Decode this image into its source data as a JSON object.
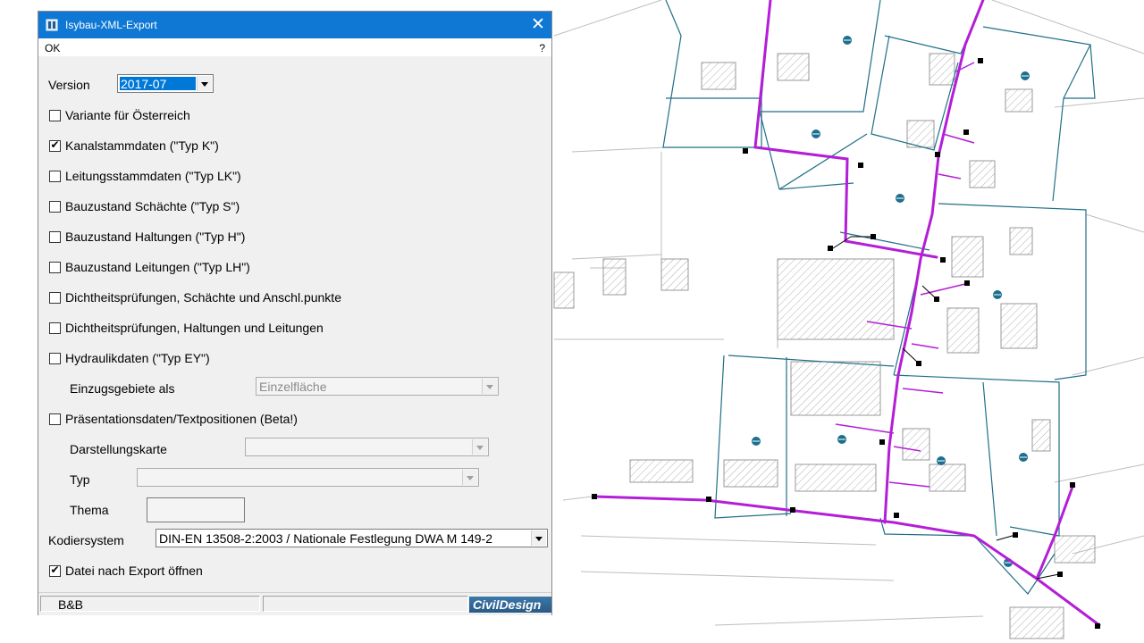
{
  "window": {
    "title": "Isybau-XML-Export",
    "menu_ok": "OK",
    "menu_help": "?",
    "close_symbol": "✕"
  },
  "form": {
    "version_label": "Version",
    "version_value": "2017-07",
    "checkboxes": [
      {
        "label": "Variante für Österreich",
        "checked": false
      },
      {
        "label": "Kanalstammdaten (\"Typ K\")",
        "checked": true
      },
      {
        "label": "Leitungsstammdaten (\"Typ LK\")",
        "checked": false
      },
      {
        "label": "Bauzustand Schächte (\"Typ S\")",
        "checked": false
      },
      {
        "label": "Bauzustand Haltungen (\"Typ H\")",
        "checked": false
      },
      {
        "label": "Bauzustand Leitungen (\"Typ LH\")",
        "checked": false
      },
      {
        "label": "Dichtheitsprüfungen, Schächte und Anschl.punkte",
        "checked": false
      },
      {
        "label": "Dichtheitsprüfungen, Haltungen und Leitungen",
        "checked": false
      },
      {
        "label": "Hydraulikdaten (\"Typ EY\")",
        "checked": false
      }
    ],
    "einzugsgebiete_label": "Einzugsgebiete als",
    "einzugsgebiete_value": "Einzelfläche",
    "praesentation_label": "Präsentationsdaten/Textpositionen (Beta!)",
    "praesentation_checked": false,
    "darstellungskarte_label": "Darstellungskarte",
    "typ_label": "Typ",
    "thema_label": "Thema",
    "kodiersystem_label": "Kodiersystem",
    "kodiersystem_value": "DIN-EN 13508-2:2003 / Nationale Festlegung DWA M 149-2",
    "datei_label": "Datei nach Export öffnen",
    "datei_checked": true
  },
  "statusbar": {
    "text": "B&B",
    "logo": "CivilDesign"
  },
  "check_mark": "✔",
  "colors": {
    "titlebar": "#0e78d4",
    "pipe": "#b31ed6",
    "parcel_outline": "#1f6f86",
    "map_lines": "#b8b8b8"
  },
  "icons": [
    "app-icon",
    "close-icon",
    "dropdown-arrow-icon",
    "manhole-icon",
    "shaft-marker-icon"
  ]
}
